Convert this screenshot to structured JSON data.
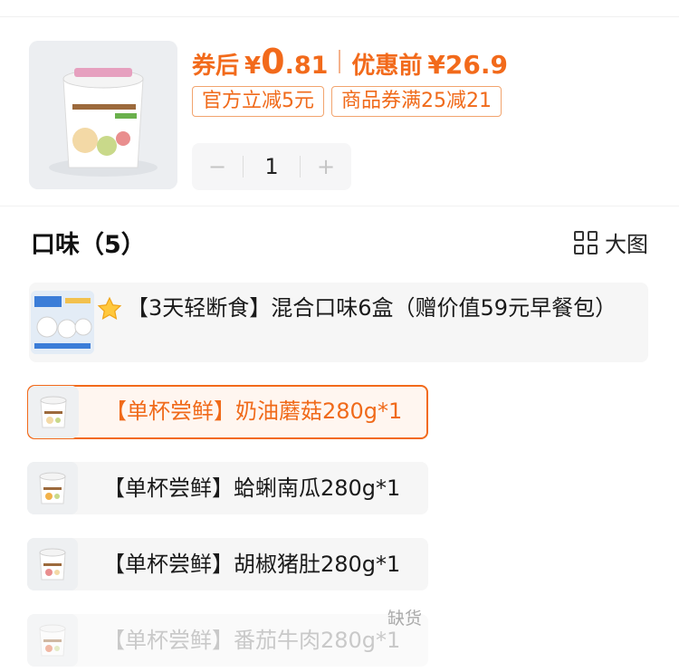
{
  "product": {
    "after_coupon_label": "券后",
    "currency": "¥",
    "price_integer": "0",
    "price_decimal": ".81",
    "before_label": "优惠前",
    "before_price": "¥26.9",
    "tags": [
      "官方立减5元",
      "商品券满25减21"
    ],
    "quantity": "1",
    "minus": "−",
    "plus": "+"
  },
  "flavors": {
    "title": "口味（5）",
    "big_view_label": "大图",
    "options": [
      {
        "label": "【3天轻断食】混合口味6盒（赠价值59元早餐包）",
        "state": "normal"
      },
      {
        "label": "【单杯尝鲜】奶油蘑菇280g*1",
        "state": "selected"
      },
      {
        "label": "【单杯尝鲜】蛤蜊南瓜280g*1",
        "state": "normal"
      },
      {
        "label": "【单杯尝鲜】胡椒猪肚280g*1",
        "state": "normal"
      },
      {
        "label": "【单杯尝鲜】番茄牛肉280g*1",
        "state": "disabled"
      }
    ],
    "out_of_stock_label": "缺货"
  },
  "icons": {
    "star": "star-icon",
    "grid": "grid-icon"
  },
  "colors": {
    "accent": "#f26a1b",
    "tag_border": "#f2a46e",
    "option_bg": "#f6f6f6",
    "selected_bg": "#fff6f0",
    "disabled_text": "#c9c9c9"
  }
}
